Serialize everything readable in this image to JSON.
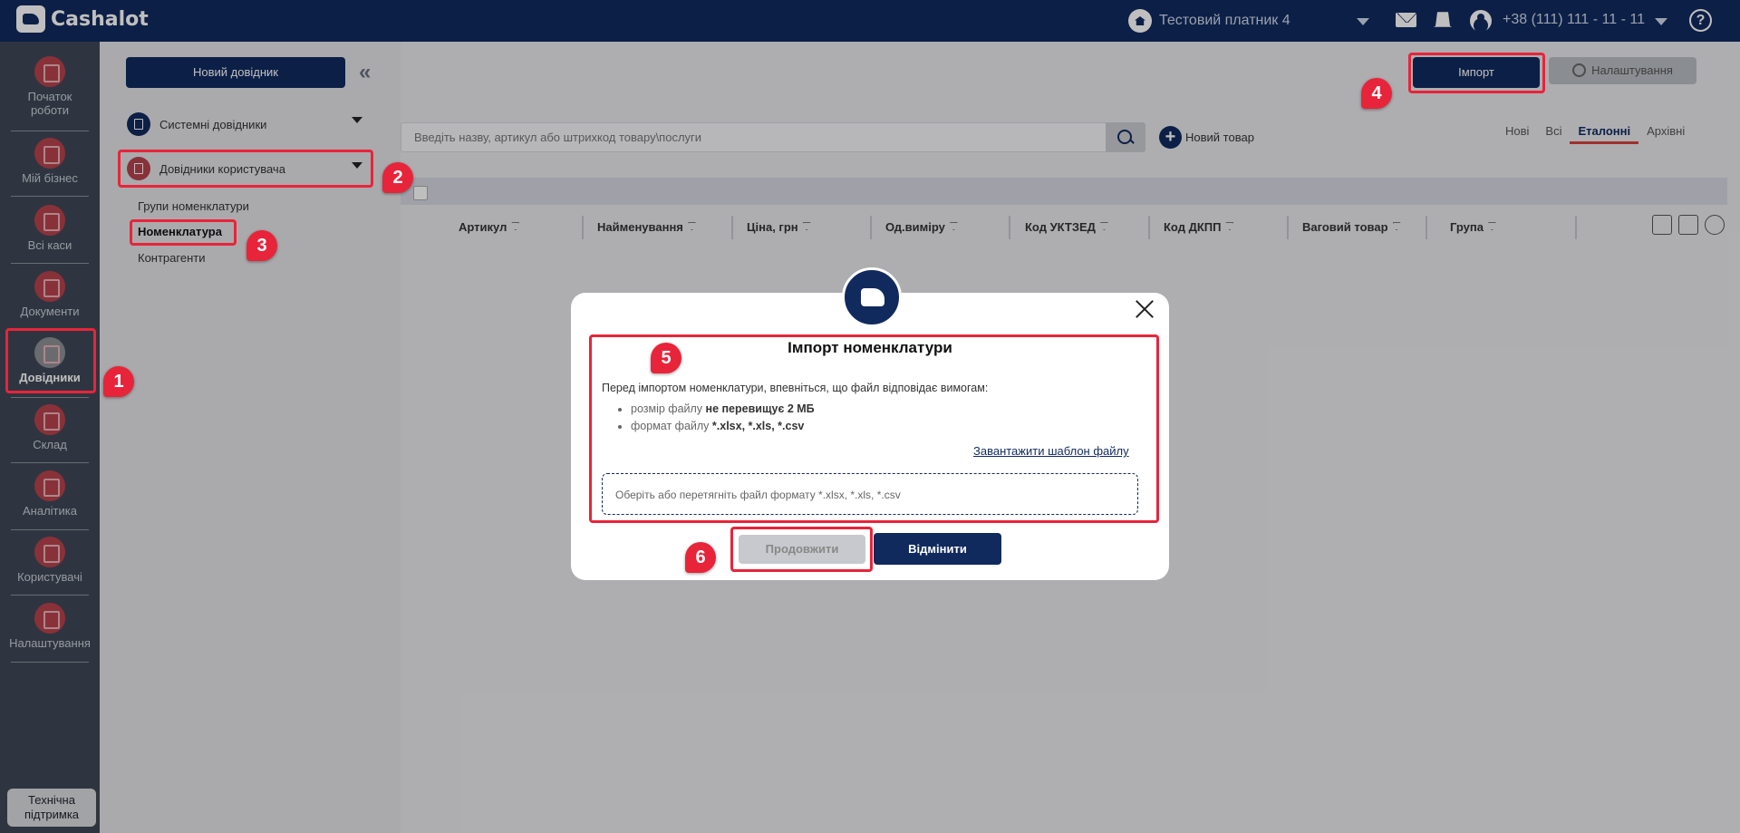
{
  "app": {
    "name": "Cashalot"
  },
  "topbar": {
    "company": "Тестовий платник 4",
    "phone": "+38 (111) 111 - 11 - 11",
    "help": "?"
  },
  "leftnav": {
    "items": [
      {
        "label": "Початок роботи",
        "icon": "rocket-icon"
      },
      {
        "label": "Мій бізнес",
        "icon": "home-icon"
      },
      {
        "label": "Всі каси",
        "icon": "register-icon"
      },
      {
        "label": "Документи",
        "icon": "documents-icon"
      },
      {
        "label": "Довідники",
        "icon": "dictionary-icon",
        "active": true
      },
      {
        "label": "Склад",
        "icon": "warehouse-icon"
      },
      {
        "label": "Аналітика",
        "icon": "analytics-icon"
      },
      {
        "label": "Користувачі",
        "icon": "users-icon"
      },
      {
        "label": "Налаштування",
        "icon": "settings-icon"
      }
    ],
    "support": "Технічна підтримка"
  },
  "dict_panel": {
    "new_button": "Новий довідник",
    "system": "Системні довідники",
    "user": "Довідники користувача",
    "sub_items": [
      "Групи номенклатури",
      "Номенклатура",
      "Контрагенти"
    ]
  },
  "main": {
    "import_button": "Імпорт",
    "settings_button": "Налаштування",
    "search_placeholder": "Введіть назву, артикул або штрихкод товару\\послуги",
    "new_goods": "Новий товар",
    "tabs": [
      "Нові",
      "Всі",
      "Еталонні",
      "Архівні"
    ],
    "active_tab": "Еталонні",
    "columns": [
      "Артикул",
      "Найменування",
      "Ціна, грн",
      "Од.виміру",
      "Код УКТЗЕД",
      "Код ДКПП",
      "Ваговий товар",
      "Група"
    ]
  },
  "modal": {
    "title": "Імпорт номенклатури",
    "intro": "Перед імпортом номенклатури, впевніться, що файл відповідає вимогам:",
    "req1_prefix": "розмір файлу ",
    "req1_value": "не перевищує 2 МБ",
    "req2_prefix": "формат файлу ",
    "req2_value": "*.xlsx, *.xls, *.csv",
    "template_link": "Завантажити шаблон файлу",
    "dropzone": "Оберіть або перетягніть файл формату *.xlsx, *.xls, *.csv",
    "continue": "Продовжити",
    "cancel": "Відмінити"
  },
  "annotations": [
    "1",
    "2",
    "3",
    "4",
    "5",
    "6"
  ],
  "colors": {
    "primary": "#112a5e",
    "accent": "#e8243a",
    "nav_bg": "#3f4756"
  }
}
